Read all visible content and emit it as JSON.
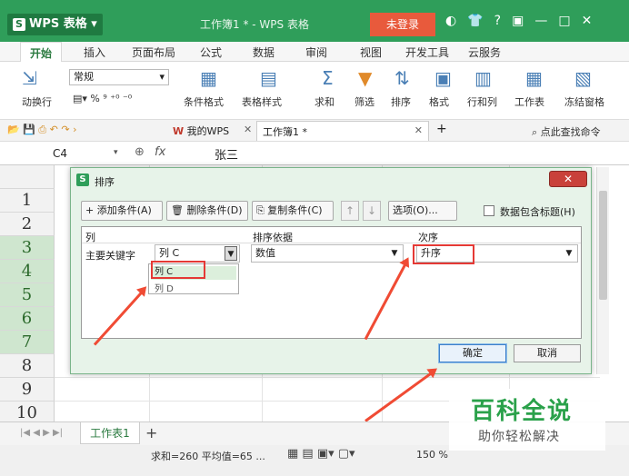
{
  "app": {
    "name": "WPS 表格",
    "window_title": "工作簿1 * - WPS 表格",
    "login": "未登录"
  },
  "tabs": [
    "开始",
    "插入",
    "页面布局",
    "公式",
    "数据",
    "审阅",
    "视图",
    "开发工具",
    "云服务"
  ],
  "ribbon": {
    "wrap": "动换行",
    "font_style": "常规",
    "cond_format": "条件格式",
    "table_style": "表格样式",
    "sum": "求和",
    "filter": "筛选",
    "sort": "排序",
    "format": "格式",
    "rowcol": "行和列",
    "sheet": "工作表",
    "freeze": "冻结窗格"
  },
  "docbar": {
    "my_wps": "我的WPS",
    "doc_tab": "工作簿1 *",
    "search_cmd": "点此查找命令"
  },
  "formula_bar": {
    "cell_ref": "C4",
    "fx": "fx",
    "value": "张三"
  },
  "rows": [
    "1",
    "2",
    "3",
    "4",
    "5",
    "6",
    "7",
    "8",
    "9",
    "10"
  ],
  "dialog": {
    "title": "排序",
    "add_condition": "添加条件(A)",
    "delete_condition": "删除条件(D)",
    "copy_condition": "复制条件(C)",
    "options": "选项(O)...",
    "header_checkbox": "数据包含标题(H)",
    "col_header": "列",
    "basis_header": "排序依据",
    "order_header": "次序",
    "key_label": "主要关键字",
    "column_value": "列 C",
    "basis_value": "数值",
    "order_value": "升序",
    "dropdown_items": [
      "列 C",
      "列 D"
    ],
    "ok": "确定",
    "cancel": "取消"
  },
  "sheet_tab": "工作表1",
  "status": {
    "summary": "求和=260  平均值=65 ...",
    "zoom": "150 %"
  },
  "watermark": {
    "big": "百科全说",
    "small": "助你轻松解决"
  },
  "colors": {
    "title_green": "#2f9e5a",
    "login_red": "#e85a3c",
    "arrow_red": "#f04b34"
  }
}
